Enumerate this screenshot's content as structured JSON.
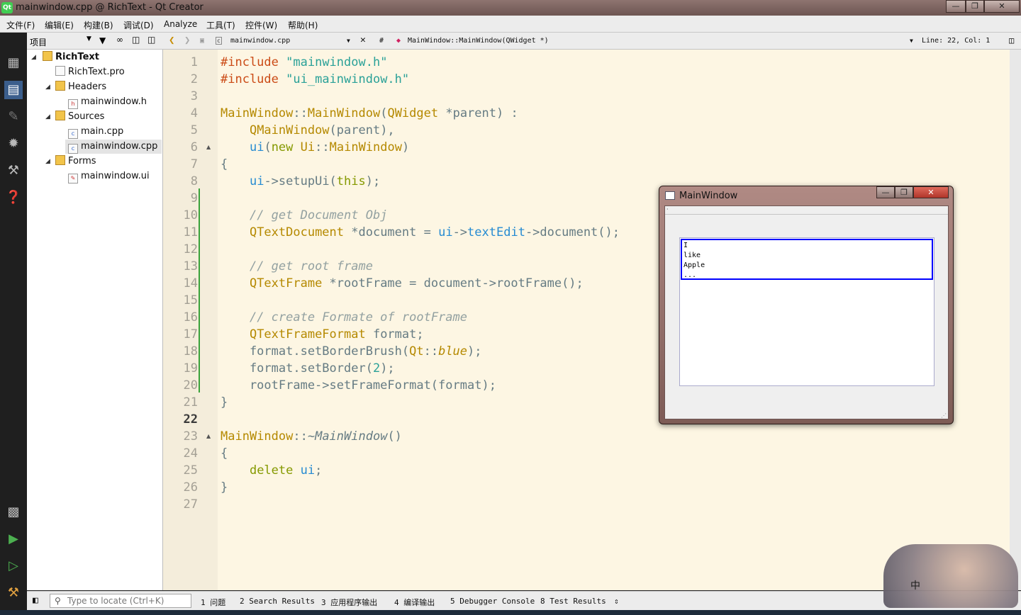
{
  "window": {
    "title": "mainwindow.cpp @ RichText - Qt Creator",
    "app_icon": "Qt"
  },
  "menu": [
    "文件(F)",
    "编辑(E)",
    "构建(B)",
    "调试(D)",
    "Analyze",
    "工具(T)",
    "控件(W)",
    "帮助(H)"
  ],
  "project_panel": {
    "title": "项目"
  },
  "tree": {
    "root": "RichText",
    "pro": "RichText.pro",
    "headers": "Headers",
    "header_file": "mainwindow.h",
    "sources": "Sources",
    "source_main": "main.cpp",
    "source_mw": "mainwindow.cpp",
    "forms": "Forms",
    "form_file": "mainwindow.ui"
  },
  "editor_header": {
    "file": "mainwindow.cpp",
    "hash": "#",
    "symbol": "MainWindow::MainWindow(QWidget *)",
    "position": "Line: 22, Col: 1"
  },
  "line_numbers": [
    "1",
    "2",
    "3",
    "4",
    "5",
    "6",
    "7",
    "8",
    "9",
    "10",
    "11",
    "12",
    "13",
    "14",
    "15",
    "16",
    "17",
    "18",
    "19",
    "20",
    "21",
    "22",
    "23",
    "24",
    "25",
    "26",
    "27"
  ],
  "current_line": "22",
  "bottom": {
    "locate_placeholder": "Type to locate (Ctrl+K)",
    "tabs": [
      "1 问题",
      "2 Search Results",
      "3 应用程序输出",
      "4 编译输出",
      "5 Debugger Console",
      "8 Test Results"
    ]
  },
  "main_window": {
    "title": "MainWindow",
    "menu_char": "·",
    "text_lines": [
      "I",
      "like",
      "Apple",
      "..."
    ]
  },
  "ime_char": "中",
  "colors": {
    "editor_bg": "#fdf6e3",
    "frame_border": "#0000ff",
    "sidebar_bg": "#1f1f1f"
  }
}
